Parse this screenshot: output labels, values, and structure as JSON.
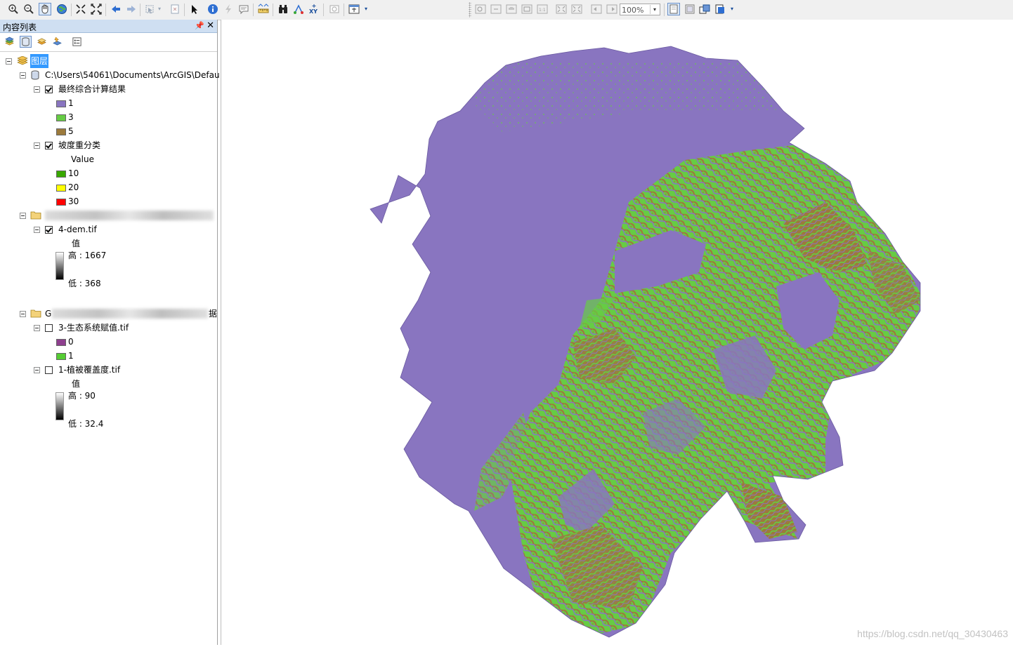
{
  "toc": {
    "title": "内容列表",
    "root_label": "图层",
    "workspace_path": "C:\\Users\\54061\\Documents\\ArcGIS\\Defau",
    "layers": [
      {
        "name": "最终综合计算结果",
        "checked": true,
        "legend": [
          {
            "label": "1",
            "color": "#8975c0"
          },
          {
            "label": "3",
            "color": "#66cc44"
          },
          {
            "label": "5",
            "color": "#9c7a3c"
          }
        ]
      },
      {
        "name": "坡度重分类",
        "checked": true,
        "field": "Value",
        "legend": [
          {
            "label": "10",
            "color": "#38a800"
          },
          {
            "label": "20",
            "color": "#ffff00"
          },
          {
            "label": "30",
            "color": "#ff0000"
          }
        ]
      },
      {
        "name": "4-dem.tif",
        "checked": true,
        "field": "值",
        "high": "高 : 1667",
        "low": "低 : 368"
      },
      {
        "name": "3-生态系统赋值.tif",
        "checked": false,
        "legend": [
          {
            "label": "0",
            "color": "#8e3f8e"
          },
          {
            "label": "1",
            "color": "#55cc33"
          }
        ]
      },
      {
        "name": "1-植被覆盖度.tif",
        "checked": false,
        "field": "值",
        "high": "高 : 90",
        "low": "低 : 32.4"
      }
    ],
    "group2_prefix": "G",
    "group2_suffix": "据"
  },
  "toolbar": {
    "zoom_level": "100%"
  },
  "map": {
    "colors": {
      "base": "#8975c0",
      "green": "#66cc44",
      "brown": "#9c7a3c"
    }
  },
  "watermark": "https://blog.csdn.net/qq_30430463"
}
